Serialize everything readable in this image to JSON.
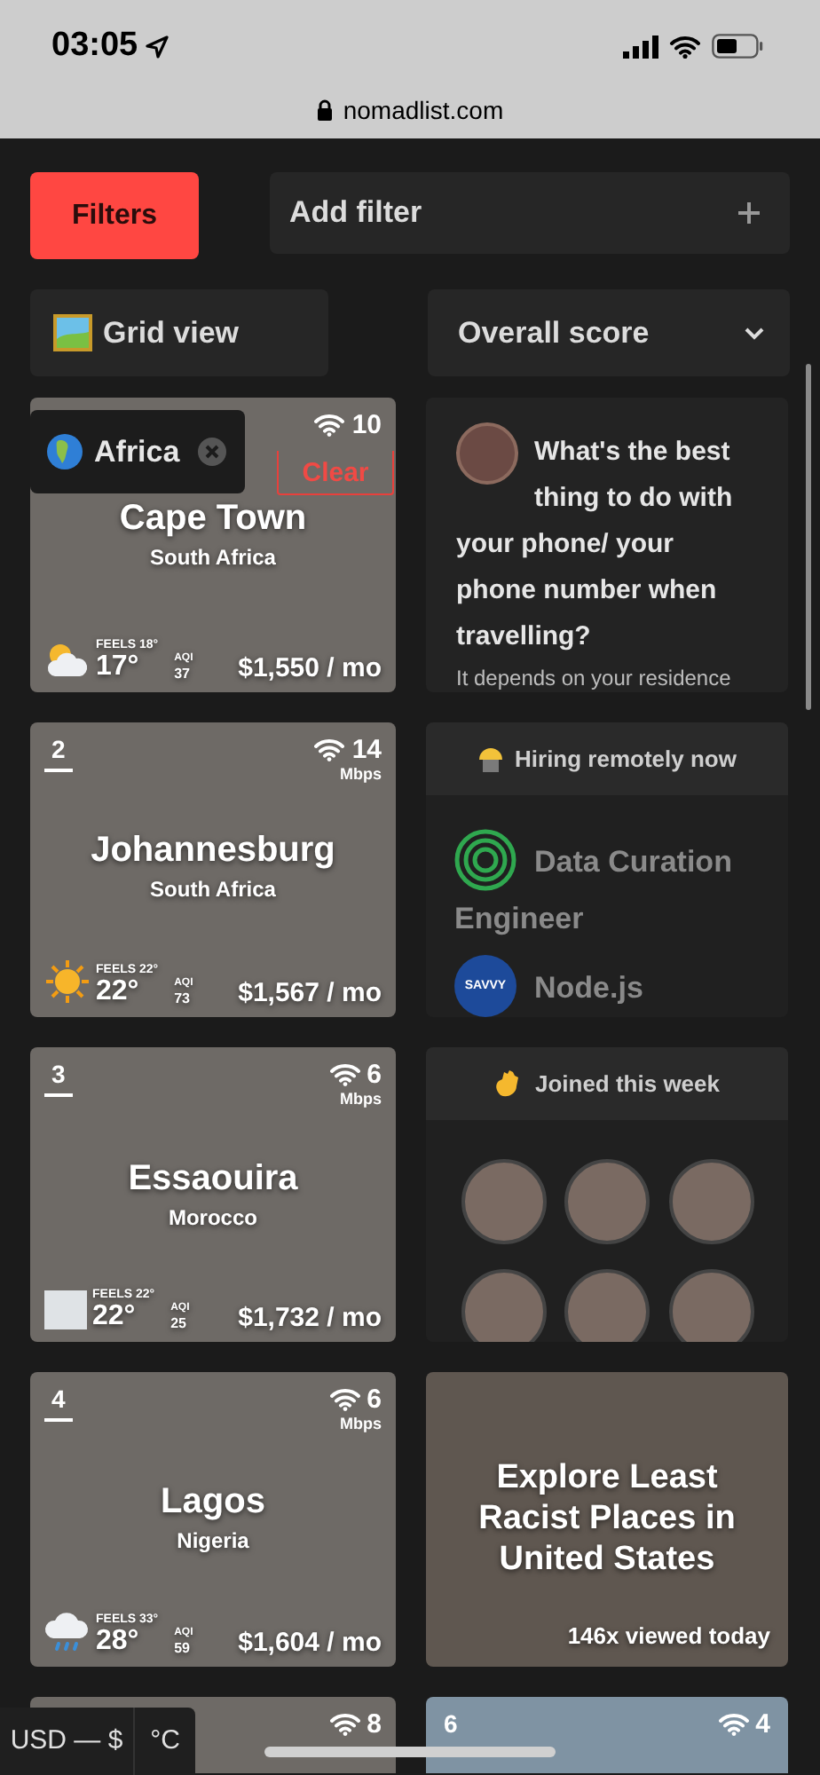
{
  "status_bar": {
    "time": "03:05",
    "url": "nomadlist.com"
  },
  "toolbar": {
    "filters": "Filters",
    "add_filter": "Add filter",
    "view": "Grid view",
    "sort": "Overall score"
  },
  "active_filter": {
    "label": "Africa",
    "clear": "Clear"
  },
  "cities": [
    {
      "name": "Cape Town",
      "country": "South Africa",
      "speed": "10",
      "feels": "FEELS 18°",
      "temp": "17°",
      "aqi_label": "AQI",
      "aqi": "37",
      "cost": "$1,550 / mo",
      "kind": "partly-cloudy"
    },
    {
      "rank": "2",
      "name": "Johannesburg",
      "country": "South Africa",
      "speed": "14",
      "speed_unit": "Mbps",
      "feels": "FEELS 22°",
      "temp": "22°",
      "aqi_label": "AQI",
      "aqi": "73",
      "cost": "$1,567 / mo",
      "kind": "sunny"
    },
    {
      "rank": "3",
      "name": "Essaouira",
      "country": "Morocco",
      "speed": "6",
      "speed_unit": "Mbps",
      "feels": "FEELS 22°",
      "temp": "22°",
      "aqi_label": "AQI",
      "aqi": "25",
      "cost": "$1,732 / mo",
      "kind": "blank"
    },
    {
      "rank": "4",
      "name": "Lagos",
      "country": "Nigeria",
      "speed": "6",
      "speed_unit": "Mbps",
      "feels": "FEELS 33°",
      "temp": "28°",
      "aqi_label": "AQI",
      "aqi": "59",
      "cost": "$1,604 / mo",
      "kind": "rainy"
    },
    {
      "speed": "8"
    }
  ],
  "question": {
    "title": "What's the best thing to do with your phone/ your phone number when travelling?",
    "excerpt": "It depends on your residence"
  },
  "hiring": {
    "title": "Hiring remotely now",
    "jobs": [
      {
        "title": "Data Curation Engineer",
        "kind": "rings"
      },
      {
        "title": "Node.js",
        "kind": "savvy",
        "logo_text": "SAVVY"
      }
    ]
  },
  "joined": {
    "title": "Joined this week",
    "members": [
      {
        "kind": "photo"
      },
      {
        "kind": "photo"
      },
      {
        "kind": "photo"
      },
      {
        "kind": "photo"
      },
      {
        "kind": "photo"
      },
      {
        "kind": "photo"
      }
    ]
  },
  "promo": {
    "title": "Explore Least Racist Places in United States",
    "views": "146x viewed today"
  },
  "next_city": {
    "rank": "6",
    "speed": "4"
  },
  "bottom_bar": {
    "currency": "USD — $",
    "unit": "°C"
  }
}
